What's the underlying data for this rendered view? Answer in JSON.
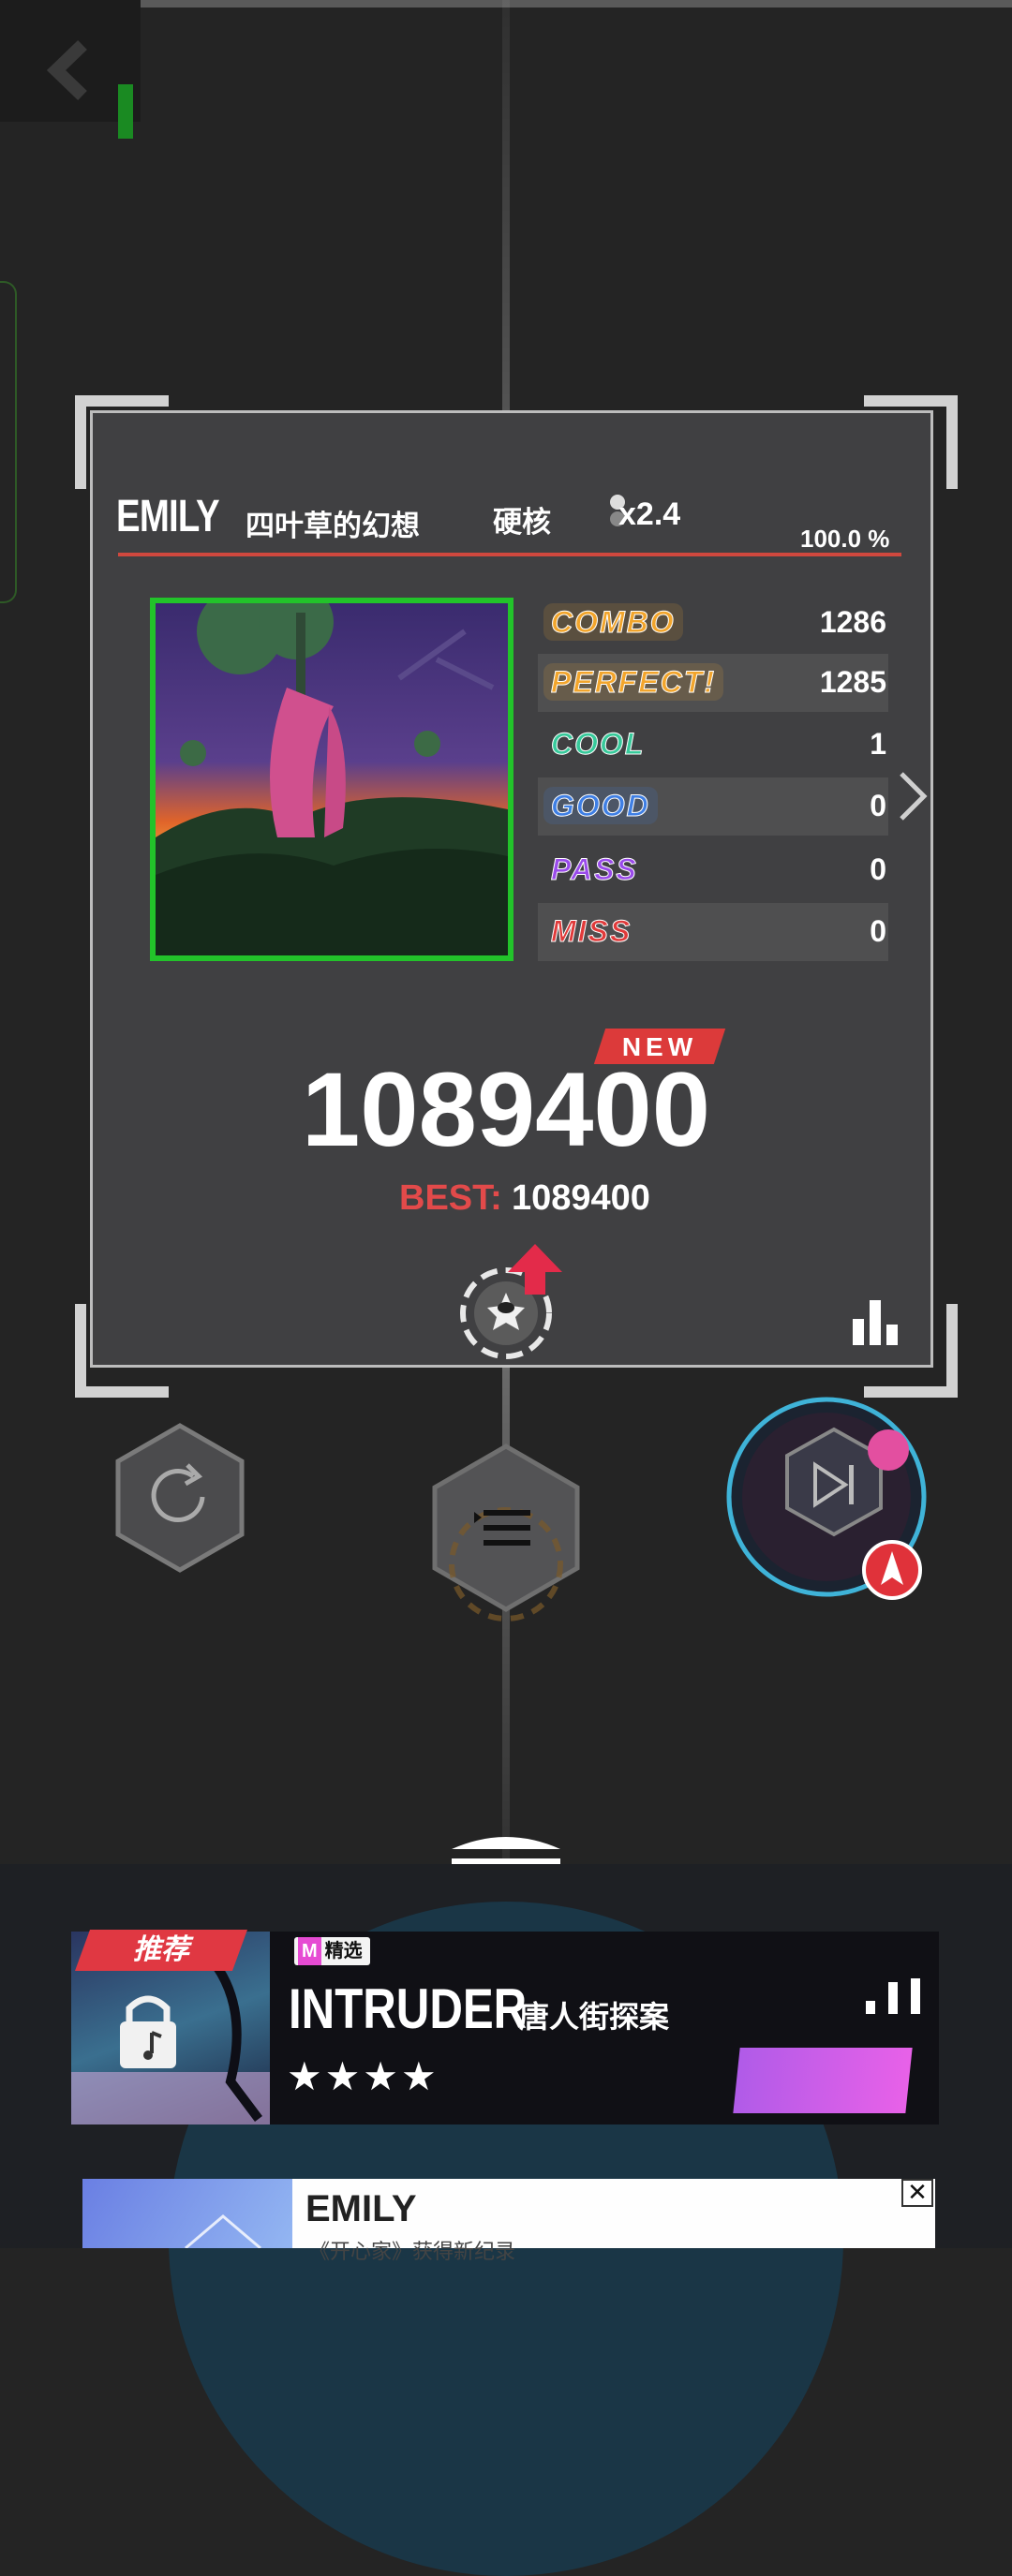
{
  "result": {
    "song_title": "EMILY",
    "song_subtitle": "四叶草的幻想",
    "difficulty": "硬核",
    "speed": "x2.4",
    "accuracy": "100.0 %",
    "stats": [
      {
        "label": "COMBO",
        "value": "1286",
        "color": "#f2a52c"
      },
      {
        "label": "PERFECT!",
        "value": "1285",
        "color": "#f2a52c"
      },
      {
        "label": "COOL",
        "value": "1",
        "color": "#37c99a"
      },
      {
        "label": "GOOD",
        "value": "0",
        "color": "#3f7fe4"
      },
      {
        "label": "PASS",
        "value": "0",
        "color": "#9a4bea"
      },
      {
        "label": "MISS",
        "value": "0",
        "color": "#e03a3a"
      }
    ],
    "new_label": "NEW",
    "score": "1089400",
    "best_label": "BEST:",
    "best_value": "1089400"
  },
  "recommend": {
    "tag": "推荐",
    "featured_m": "M",
    "featured_label": "精选",
    "title": "INTRUDER",
    "subtitle": "唐人街探案",
    "stars": "★★★★"
  },
  "ad": {
    "title": "EMILY",
    "subtitle": "《开心家》获得新纪录",
    "close": "✕"
  },
  "colors": {
    "accent_red": "#e03a3a",
    "cover_border": "#22c32a",
    "panel_bg": "#404042"
  },
  "icons": [
    "back-arrow-icon",
    "retry-icon",
    "song-list-icon",
    "next-song-icon",
    "settings-gear-icon",
    "stats-bars-icon",
    "chevron-right-icon",
    "lock-icon"
  ]
}
